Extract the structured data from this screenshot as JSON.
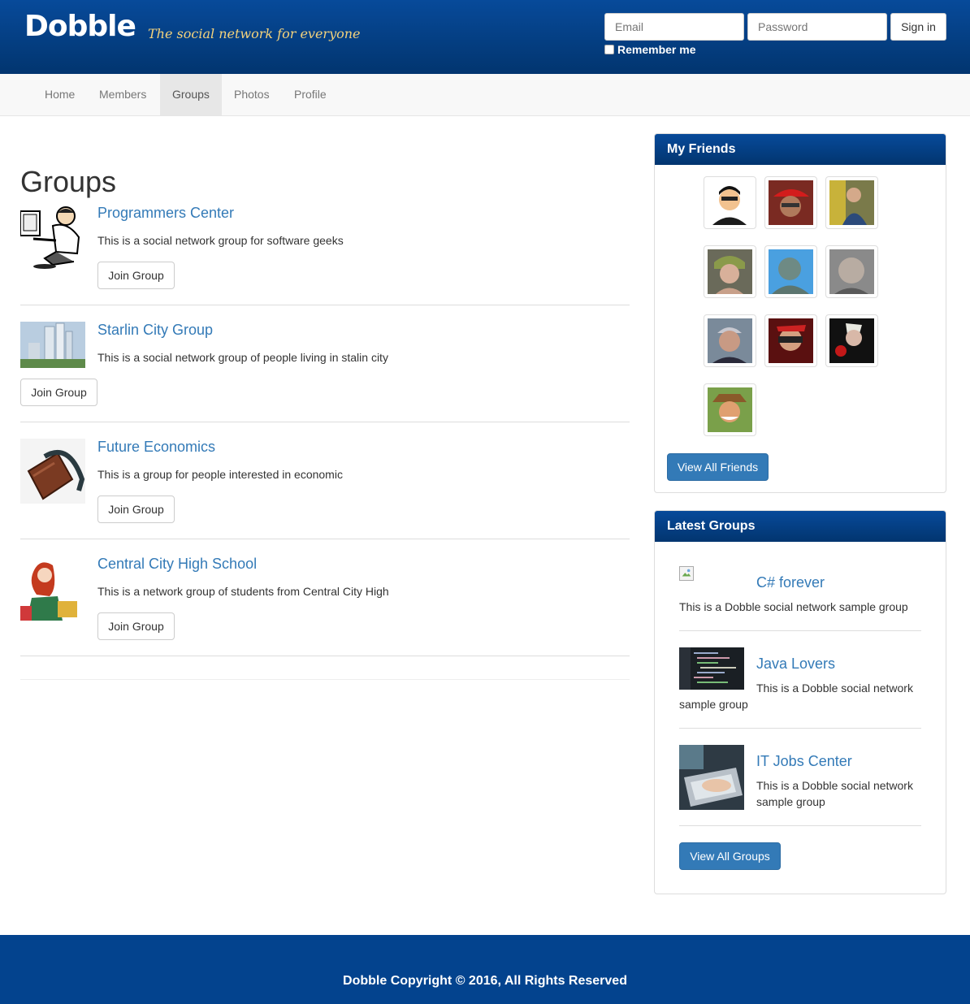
{
  "header": {
    "logo": "Dobble",
    "tagline": "The social network for everyone",
    "email_placeholder": "Email",
    "password_placeholder": "Password",
    "signin_label": "Sign in",
    "remember_label": "Remember me"
  },
  "nav": {
    "items": [
      {
        "label": "Home"
      },
      {
        "label": "Members"
      },
      {
        "label": "Groups"
      },
      {
        "label": "Photos"
      },
      {
        "label": "Profile"
      }
    ],
    "active": "Groups"
  },
  "main": {
    "title": "Groups",
    "groups": [
      {
        "name": "Programmers Center",
        "description": "This is a social network group for software geeks",
        "button": "Join Group"
      },
      {
        "name": "Starlin City Group",
        "description": "This is a social network group of people living in stalin city",
        "button": "Join Group"
      },
      {
        "name": "Future Economics",
        "description": "This is a group for people interested in economic",
        "button": "Join Group"
      },
      {
        "name": "Central City High School",
        "description": "This is a network group of students from Central City High",
        "button": "Join Group"
      }
    ]
  },
  "friends_panel": {
    "title": "My Friends",
    "button": "View All Friends"
  },
  "latest_panel": {
    "title": "Latest Groups",
    "items": [
      {
        "name": "C# forever",
        "description": "This is a Dobble social network sample group"
      },
      {
        "name": "Java Lovers",
        "description_line1": "This is a Dobble social network",
        "description_line2": "sample group"
      },
      {
        "name": "IT Jobs Center",
        "description_line1": "This is a Dobble social network",
        "description_line2": "sample group"
      }
    ],
    "button": "View All Groups"
  },
  "footer": {
    "text": "Dobble Copyright © 2016, All Rights Reserved"
  },
  "colors": {
    "header_blue": "#02356f",
    "link_blue": "#337ab7",
    "tagline_gold": "#f3d27c"
  }
}
